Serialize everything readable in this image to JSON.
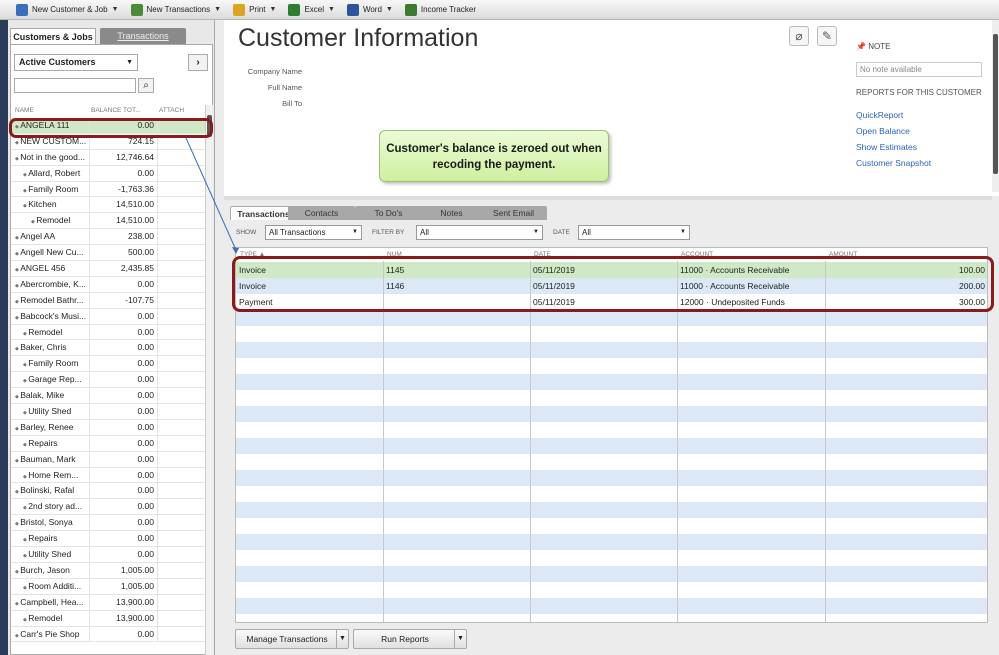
{
  "toolbar": {
    "items": [
      {
        "label": "New Customer & Job",
        "dropdown": true,
        "icon": "new-customer-icon",
        "color": "#3a6fb8"
      },
      {
        "label": "New Transactions",
        "dropdown": true,
        "icon": "new-transactions-icon",
        "color": "#4a8a3a"
      },
      {
        "label": "Print",
        "dropdown": true,
        "icon": "print-icon",
        "color": "#d9a520"
      },
      {
        "label": "Excel",
        "dropdown": true,
        "icon": "excel-icon",
        "color": "#2e7d32"
      },
      {
        "label": "Word",
        "dropdown": true,
        "icon": "word-icon",
        "color": "#2b579a"
      },
      {
        "label": "Income Tracker",
        "dropdown": false,
        "icon": "income-tracker-icon",
        "color": "#3d7a2f"
      }
    ]
  },
  "left": {
    "tabs": {
      "customers": "Customers & Jobs",
      "transactions": "Transactions"
    },
    "filter": "Active Customers",
    "columns": {
      "name": "NAME",
      "balance": "BALANCE TOT...",
      "attach": "ATTACH"
    },
    "rows": [
      {
        "name": "ANGELA 111",
        "balance": "0.00",
        "level": 0,
        "selected": true
      },
      {
        "name": "NEW CUSTOM...",
        "balance": "724.15",
        "level": 0
      },
      {
        "name": "Not in the good...",
        "balance": "12,746.64",
        "level": 0
      },
      {
        "name": "Allard, Robert",
        "balance": "0.00",
        "level": 1
      },
      {
        "name": "Family Room",
        "balance": "-1,763.36",
        "level": 1
      },
      {
        "name": "Kitchen",
        "balance": "14,510.00",
        "level": 1
      },
      {
        "name": "Remodel",
        "balance": "14,510.00",
        "level": 2
      },
      {
        "name": "Angel AA",
        "balance": "238.00",
        "level": 0
      },
      {
        "name": "Angell New Cu...",
        "balance": "500.00",
        "level": 0
      },
      {
        "name": "ANGEL 456",
        "balance": "2,435.85",
        "level": 0
      },
      {
        "name": "Abercrombie, K...",
        "balance": "0.00",
        "level": 0
      },
      {
        "name": "Remodel Bathr...",
        "balance": "-107.75",
        "level": 0
      },
      {
        "name": "Babcock's Musi...",
        "balance": "0.00",
        "level": 0
      },
      {
        "name": "Remodel",
        "balance": "0.00",
        "level": 1
      },
      {
        "name": "Baker, Chris",
        "balance": "0.00",
        "level": 0
      },
      {
        "name": "Family Room",
        "balance": "0.00",
        "level": 1
      },
      {
        "name": "Garage Rep...",
        "balance": "0.00",
        "level": 1
      },
      {
        "name": "Balak, Mike",
        "balance": "0.00",
        "level": 0
      },
      {
        "name": "Utility Shed",
        "balance": "0.00",
        "level": 1
      },
      {
        "name": "Barley, Renee",
        "balance": "0.00",
        "level": 0
      },
      {
        "name": "Repairs",
        "balance": "0.00",
        "level": 1
      },
      {
        "name": "Bauman, Mark",
        "balance": "0.00",
        "level": 0
      },
      {
        "name": "Home Rem...",
        "balance": "0.00",
        "level": 1
      },
      {
        "name": "Bolinski, Rafal",
        "balance": "0.00",
        "level": 0
      },
      {
        "name": "2nd story ad...",
        "balance": "0.00",
        "level": 1
      },
      {
        "name": "Bristol, Sonya",
        "balance": "0.00",
        "level": 0
      },
      {
        "name": "Repairs",
        "balance": "0.00",
        "level": 1
      },
      {
        "name": "Utility Shed",
        "balance": "0.00",
        "level": 1
      },
      {
        "name": "Burch, Jason",
        "balance": "1,005.00",
        "level": 0
      },
      {
        "name": "Room Additi...",
        "balance": "1,005.00",
        "level": 1
      },
      {
        "name": "Campbell, Hea...",
        "balance": "13,900.00",
        "level": 0
      },
      {
        "name": "Remodel",
        "balance": "13,900.00",
        "level": 1
      },
      {
        "name": "Carr's Pie Shop",
        "balance": "0.00",
        "level": 0
      }
    ]
  },
  "info": {
    "title": "Customer Information",
    "fields": {
      "company": "Company Name",
      "fullname": "Full Name",
      "billto": "Bill To"
    },
    "callout": "Customer's balance is zeroed out when recoding the payment.",
    "note_label": "NOTE",
    "note_value": "No note available",
    "reports_head": "REPORTS FOR THIS CUSTOMER",
    "reports": [
      "QuickReport",
      "Open Balance",
      "Show Estimates",
      "Customer Snapshot"
    ]
  },
  "tx": {
    "tabs": [
      "Transactions",
      "Contacts",
      "To Do's",
      "Notes",
      "Sent Email"
    ],
    "filters": {
      "show_label": "SHOW",
      "show_value": "All Transactions",
      "filter_label": "FILTER BY",
      "filter_value": "All",
      "date_label": "DATE",
      "date_value": "All"
    },
    "columns": {
      "type": "TYPE",
      "num": "NUM",
      "date": "DATE",
      "account": "ACCOUNT",
      "amount": "AMOUNT"
    },
    "rows": [
      {
        "type": "Invoice",
        "num": "1145",
        "date": "05/11/2019",
        "account": "11000 · Accounts Receivable",
        "amount": "100.00"
      },
      {
        "type": "Invoice",
        "num": "1146",
        "date": "05/11/2019",
        "account": "11000 · Accounts Receivable",
        "amount": "200.00"
      },
      {
        "type": "Payment",
        "num": "",
        "date": "05/11/2019",
        "account": "12000 · Undeposited Funds",
        "amount": "300.00"
      }
    ],
    "buttons": {
      "manage": "Manage Transactions",
      "reports": "Run Reports"
    }
  },
  "colors": {
    "highlight_border": "#8b1a1a",
    "selected_row": "#cfe9c7",
    "alt_row": "#dce8f5",
    "link": "#2a64b6"
  }
}
